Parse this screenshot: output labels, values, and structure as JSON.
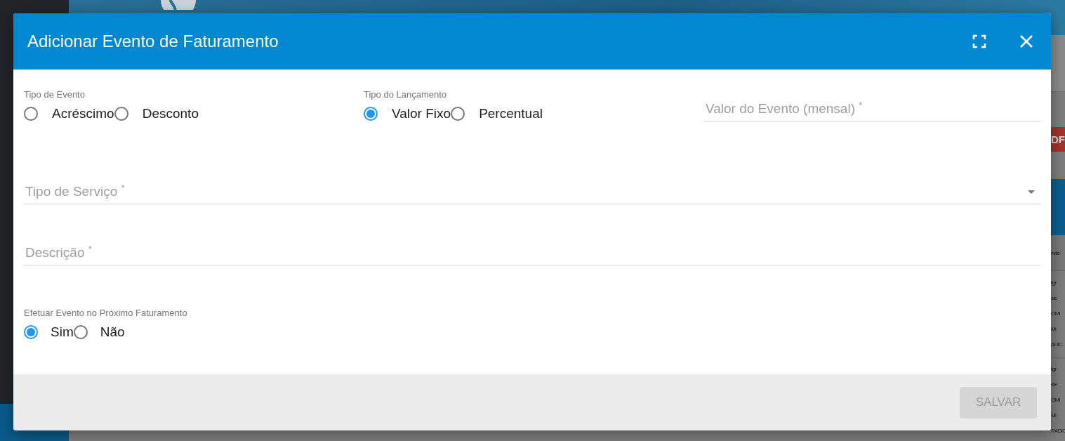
{
  "background": {
    "button_fragment": "DF",
    "column_fragment": "rvic",
    "row_groups": [
      [
        "ligr",
        "ste",
        "OMI",
        "MI",
        "ADIC"
      ],
      [
        "ligr",
        "ste",
        "OMI",
        "MI",
        "RADIC"
      ]
    ]
  },
  "dialog": {
    "title": "Adicionar Evento de Faturamento",
    "radio_groups_top": [
      {
        "label": "Tipo de Evento",
        "options": [
          {
            "label": "Acréscimo",
            "selected": false
          },
          {
            "label": "Desconto",
            "selected": false
          }
        ]
      },
      {
        "label": "Tipo do Lançamento",
        "options": [
          {
            "label": "Valor Fixo",
            "selected": true
          },
          {
            "label": "Percentual",
            "selected": false
          }
        ]
      }
    ],
    "value_field": {
      "kind": "text",
      "label": "Valor do Evento (mensal) $^{*}$"
    },
    "fields": [
      {
        "kind": "select",
        "label": "Tipo de Serviço $^{*}$"
      },
      {
        "kind": "text",
        "label": "Descrição $^{*}$"
      }
    ],
    "radio_group_bottom": {
      "label": "Efetuar Evento no Próximo Faturamento",
      "options": [
        {
          "label": "Sim",
          "selected": true
        },
        {
          "label": "Não",
          "selected": false
        }
      ]
    },
    "save_button": {
      "label": "SALVAR",
      "disabled": true
    }
  }
}
